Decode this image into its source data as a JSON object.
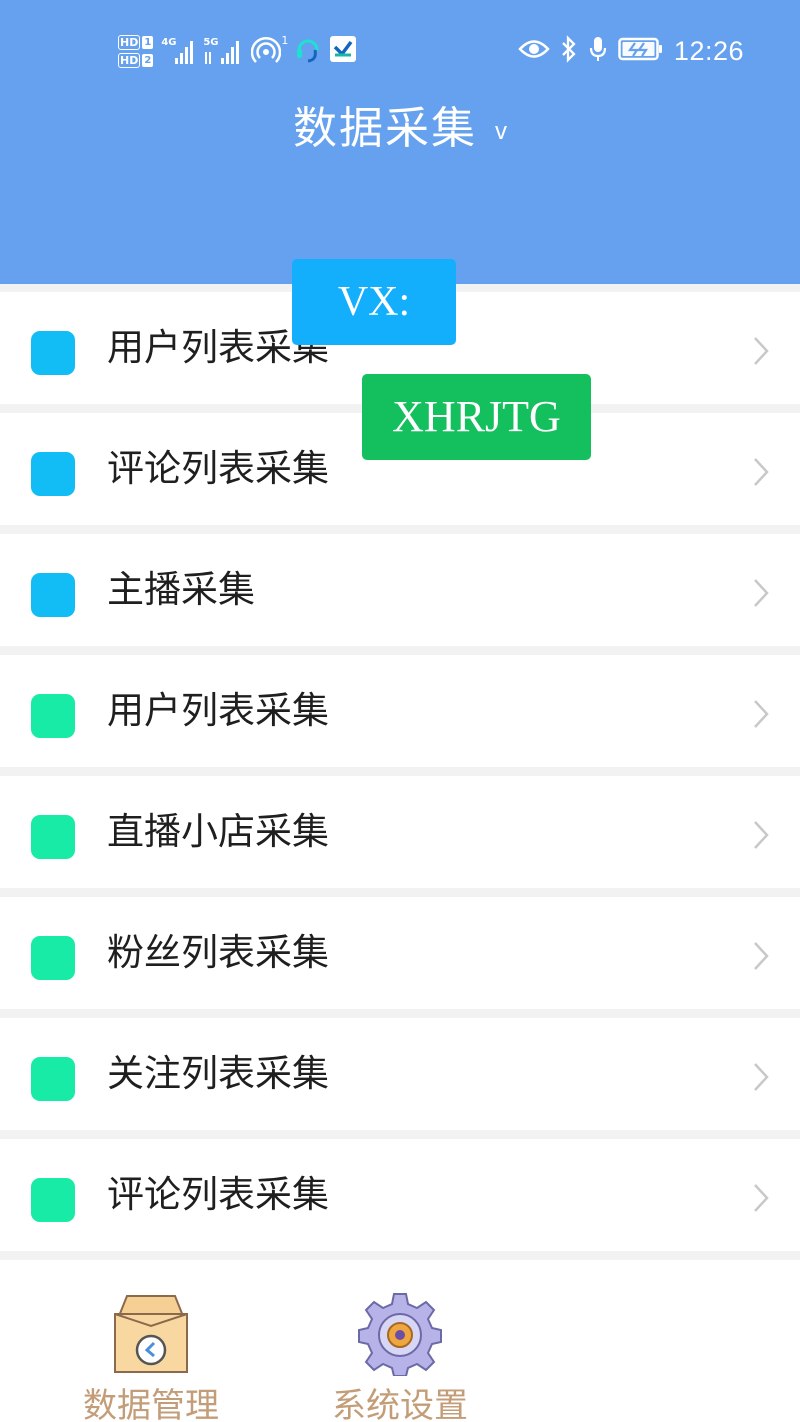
{
  "status_bar": {
    "sim1": "HD",
    "sim1_num": "1",
    "sim2": "HD",
    "sim2_num": "2",
    "net1": "4G",
    "net2": "5G",
    "hotspot_count": "1",
    "time": "12:26"
  },
  "header": {
    "title": "数据采集",
    "caret": "v"
  },
  "list": {
    "items": [
      {
        "label": "用户列表采集",
        "dot_color": "#12bdf6"
      },
      {
        "label": "评论列表采集",
        "dot_color": "#12bdf6"
      },
      {
        "label": "主播采集",
        "dot_color": "#12bdf6"
      },
      {
        "label": "用户列表采集",
        "dot_color": "#17eba6"
      },
      {
        "label": "直播小店采集",
        "dot_color": "#17eba6"
      },
      {
        "label": "粉丝列表采集",
        "dot_color": "#17eba6"
      },
      {
        "label": "关注列表采集",
        "dot_color": "#17eba6"
      },
      {
        "label": "评论列表采集",
        "dot_color": "#17eba6"
      }
    ]
  },
  "tags": {
    "vx_label": "VX:",
    "vx_color": "#13aefc",
    "id_label": "XHRJTG",
    "id_color": "#14c05d"
  },
  "bottom_nav": {
    "items": [
      {
        "label": "数据管理",
        "icon": "archive-box-clock-icon"
      },
      {
        "label": "系统设置",
        "icon": "gear-icon"
      }
    ],
    "label_color": "#c39d78"
  },
  "colors": {
    "header_bg": "#65a1ee",
    "page_bg": "#f2f2f2",
    "chevron": "#c8c8c8"
  }
}
